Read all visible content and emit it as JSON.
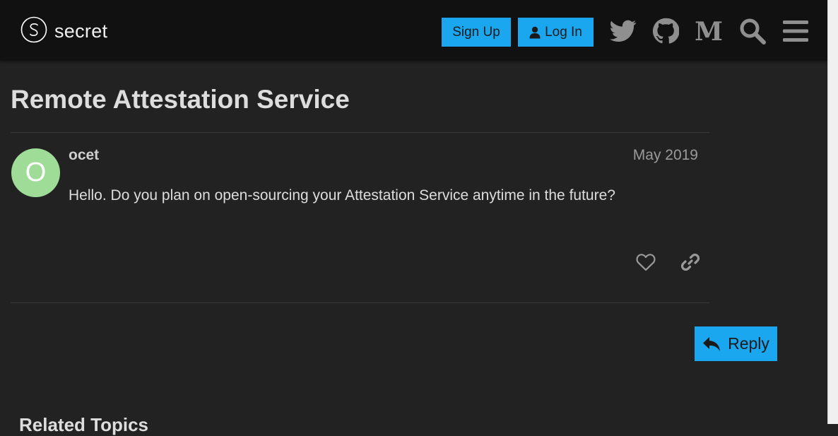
{
  "header": {
    "logo_text": "secret",
    "signup_label": "Sign Up",
    "login_label": "Log In",
    "icons": [
      "twitter-icon",
      "github-icon",
      "medium-icon",
      "search-icon",
      "hamburger-menu-icon"
    ]
  },
  "topic": {
    "title": "Remote Attestation Service"
  },
  "post": {
    "avatar_letter": "O",
    "username": "ocet",
    "date": "May 2019",
    "body": "Hello. Do you plan on open-sourcing your Attestation Service anytime in the future?"
  },
  "actions": {
    "reply_label": "Reply"
  },
  "related": {
    "heading": "Related Topics"
  },
  "colors": {
    "accent": "#1aa7f0",
    "background": "#222222",
    "header_background": "#111111",
    "avatar": "#9fdc97"
  }
}
